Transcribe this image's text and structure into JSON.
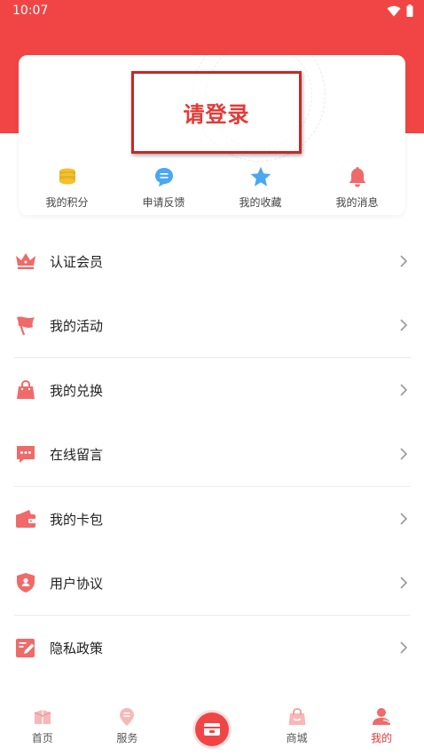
{
  "status_bar": {
    "time": "10:07"
  },
  "login": {
    "prompt": "请登录"
  },
  "shortcuts": [
    {
      "label": "我的积分",
      "icon": "coins-icon",
      "color": "#f2c12e"
    },
    {
      "label": "申请反馈",
      "icon": "chat-bubble-icon",
      "color": "#4aa8f0"
    },
    {
      "label": "我的收藏",
      "icon": "star-icon",
      "color": "#4aa8f0"
    },
    {
      "label": "我的消息",
      "icon": "bell-icon",
      "color": "#f06a6a"
    }
  ],
  "menu": [
    {
      "label": "认证会员",
      "icon": "crown-icon"
    },
    {
      "label": "我的活动",
      "icon": "flag-icon"
    },
    {
      "label": "我的兑换",
      "icon": "shopping-bag-icon"
    },
    {
      "label": "在线留言",
      "icon": "message-icon"
    },
    {
      "label": "我的卡包",
      "icon": "wallet-icon"
    },
    {
      "label": "用户协议",
      "icon": "shield-user-icon"
    },
    {
      "label": "隐私政策",
      "icon": "edit-document-icon"
    }
  ],
  "tabbar": [
    {
      "label": "首页",
      "icon": "home-icon",
      "active": false
    },
    {
      "label": "服务",
      "icon": "location-pin-icon",
      "active": false
    },
    {
      "label": "",
      "icon": "center-card-icon",
      "active": false
    },
    {
      "label": "商城",
      "icon": "shop-bag-icon",
      "active": false
    },
    {
      "label": "我的",
      "icon": "user-icon",
      "active": true
    }
  ],
  "colors": {
    "brand": "#f14545",
    "accent_text": "#e53935",
    "highlight_border": "#c62828"
  }
}
